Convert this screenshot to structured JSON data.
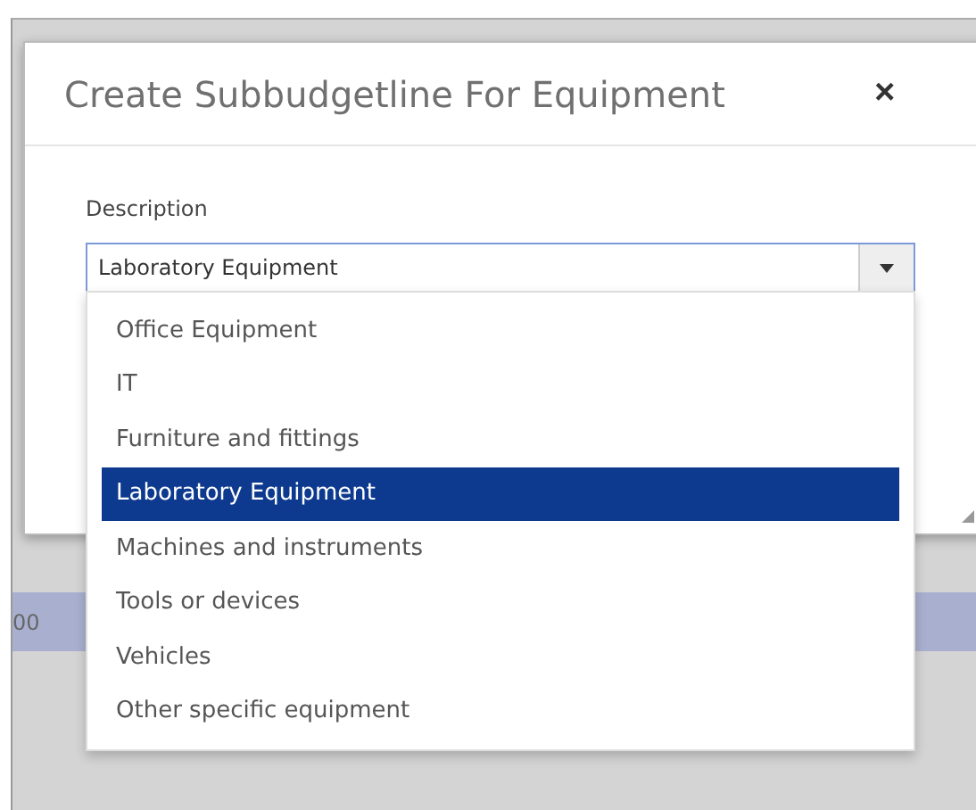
{
  "background": {
    "row_fragment": "00"
  },
  "dialog": {
    "title": "Create Subbudgetline For Equipment",
    "close": "×"
  },
  "field": {
    "label": "Description",
    "value": "Laboratory Equipment",
    "expanded": true
  },
  "options": [
    {
      "label": "Office Equipment",
      "selected": false
    },
    {
      "label": "IT",
      "selected": false
    },
    {
      "label": "Furniture and fittings",
      "selected": false
    },
    {
      "label": "Laboratory Equipment",
      "selected": true
    },
    {
      "label": "Machines and instruments",
      "selected": false
    },
    {
      "label": "Tools or devices",
      "selected": false
    },
    {
      "label": "Vehicles",
      "selected": false
    },
    {
      "label": "Other specific equipment",
      "selected": false
    }
  ]
}
